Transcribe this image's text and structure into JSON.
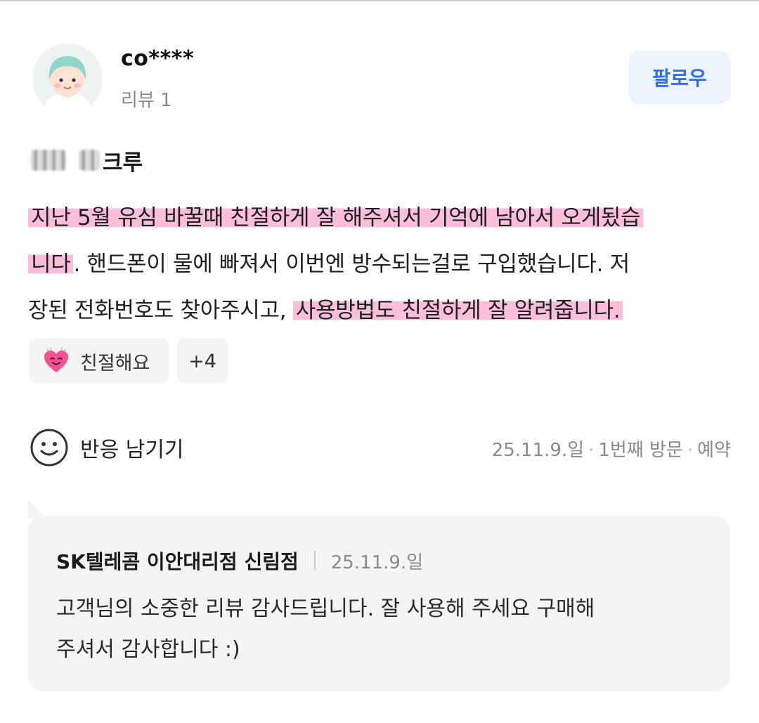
{
  "reviewer": {
    "name": "co****",
    "review_count": "리뷰 1",
    "follow_label": "팔로우"
  },
  "menu": {
    "name": "크루"
  },
  "review": {
    "lines": [
      [
        {
          "text": "지난 5월 유심 바꿀때 친절하게 잘 해주셔서 기억에 남아서 오게됬습",
          "highlight": true
        }
      ],
      [
        {
          "text": "니다",
          "highlight": true
        },
        {
          "text": ". 핸드폰이 물에 빠져서 이번엔 방수되는걸로 구입했습니다. 저",
          "highlight": false
        }
      ],
      [
        {
          "text": "장된 전화번호도 찾아주시고, ",
          "highlight": false
        },
        {
          "text": "사용방법도 친절하게 잘 알려줍니다.",
          "highlight": true
        }
      ]
    ]
  },
  "keywords": {
    "first_label": "친절해요",
    "first_icon": "smiling-heart-icon",
    "more_label": "+4"
  },
  "reaction": {
    "label": "반응 남기기",
    "icon": "smiley-icon"
  },
  "visit": {
    "date": "25.11.9.일",
    "count": "1번째 방문",
    "type": "예약"
  },
  "reply": {
    "shop_name": "SK텔레콤 이안대리점 신림점",
    "date": "25.11.9.일",
    "lines": [
      "고객님의 소중한 리뷰 감사드립니다. 잘 사용해 주세요 구매해",
      "주셔서 감사합니다 :)"
    ]
  },
  "colors": {
    "highlight": "#fbbfdc",
    "follow_text": "#2f6fea",
    "follow_bg": "#eef4ff",
    "reply_bg": "#f4f4f4"
  }
}
